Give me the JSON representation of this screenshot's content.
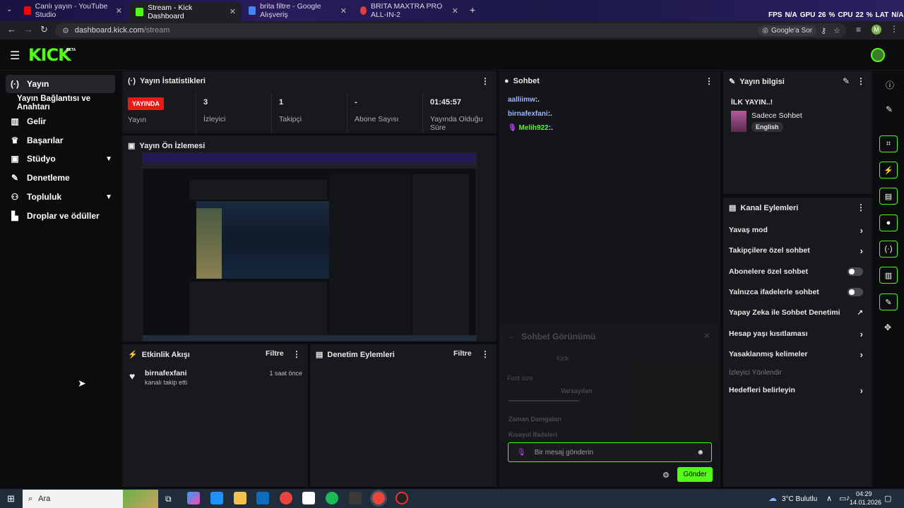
{
  "browser": {
    "tabs": [
      {
        "title": "Canlı yayın - YouTube Studio",
        "color": "#ff0000"
      },
      {
        "title": "Stream - Kick Dashboard",
        "color": "#53fc18",
        "active": true
      },
      {
        "title": "brita filtre - Google Alışveriş",
        "color": "#4285f4"
      },
      {
        "title": "BRITA MAXTRA PRO ALL-IN-2",
        "color": "#e04040"
      }
    ],
    "url_domain": "dashboard.kick.com",
    "url_path": "/stream",
    "google_lens": "Google'a Sor",
    "perf": {
      "fps_label": "FPS",
      "fps": "N/A",
      "gpu_label": "GPU",
      "gpu": "26",
      "cpu_label": "CPU",
      "cpu": "22",
      "lat_label": "LAT",
      "lat": "N/A",
      "pct": "%"
    }
  },
  "brand": {
    "logo": "KICK",
    "beta": "BETA",
    "accent": "#53fc18"
  },
  "sidebar": {
    "items": [
      {
        "label": "Yayın",
        "icon": "broadcast-icon"
      },
      {
        "label": "Yayın Bağlantısı ve Anahtarı"
      },
      {
        "label": "Gelir",
        "icon": "chart-icon"
      },
      {
        "label": "Başarılar",
        "icon": "trophy-icon"
      },
      {
        "label": "Stüdyo",
        "icon": "studio-icon"
      },
      {
        "label": "Denetleme",
        "icon": "wrench-icon"
      },
      {
        "label": "Topluluk",
        "icon": "community-icon"
      },
      {
        "label": "Droplar ve ödüller",
        "icon": "drops-icon"
      }
    ]
  },
  "stats": {
    "title": "Yayın İstatistikleri",
    "live_badge": "YAYINDA",
    "live_label": "Yayın",
    "viewers": {
      "value": "3",
      "label": "İzleyici"
    },
    "followers": {
      "value": "1",
      "label": "Takipçi"
    },
    "subs": {
      "value": "-",
      "label": "Abone Sayısı"
    },
    "duration": {
      "value": "01:45:57",
      "label": "Yayında Olduğu Süre"
    }
  },
  "preview": {
    "title": "Yayın Ön İzlemesi"
  },
  "activity": {
    "title": "Etkinlik Akışı",
    "filter": "Filtre",
    "events": [
      {
        "user": "birnafexfani",
        "text": "kanalı takip etti",
        "time": "1 saat önce"
      }
    ]
  },
  "modlog": {
    "title": "Denetim Eylemleri",
    "filter": "Filtre"
  },
  "chat": {
    "title": "Sohbet",
    "messages": [
      {
        "user": "aalliimw",
        "text": ":.",
        "color": "#9db4ff"
      },
      {
        "user": "birnafexfani",
        "text": ":.",
        "color": "#9db4ff"
      },
      {
        "user": "Melih922",
        "text": ":.",
        "color": "#53fc18"
      }
    ],
    "overlay": {
      "title": "Sohbet Görünümü",
      "fontsize": "Font size",
      "default": "Varsayılan",
      "timestamps": "Zaman Damgaları",
      "shortcuts": "Kısayol İfadeleri",
      "kick": "Kick"
    },
    "input_placeholder": "Bir mesaj gönderin",
    "send": "Gönder"
  },
  "streaminfo": {
    "title": "Yayın bilgisi",
    "stream_title": "İLK YAYIN..!",
    "category": "Sadece Sohbet",
    "language": "English"
  },
  "channel_actions": {
    "title": "Kanal Eylemleri",
    "items": [
      {
        "label": "Yavaş mod",
        "type": "arrow"
      },
      {
        "label": "Takipçilere özel sohbet",
        "type": "arrow"
      },
      {
        "label": "Abonelere özel sohbet",
        "type": "toggle"
      },
      {
        "label": "Yalnızca ifadelerle sohbet",
        "type": "toggle"
      },
      {
        "label": "Yapay Zeka ile Sohbet Denetimi",
        "type": "external"
      },
      {
        "label": "Hesap yaşı kısıtlaması",
        "type": "arrow"
      },
      {
        "label": "Yasaklanmış kelimeler",
        "type": "arrow"
      },
      {
        "label": "İzleyici Yönlendir",
        "type": "disabled"
      },
      {
        "label": "Hedefleri belirleyin",
        "type": "arrow"
      }
    ]
  },
  "taskbar": {
    "search": "Ara",
    "weather": "3°C  Bulutlu",
    "time": "04:29",
    "date": "14.01.2026"
  }
}
